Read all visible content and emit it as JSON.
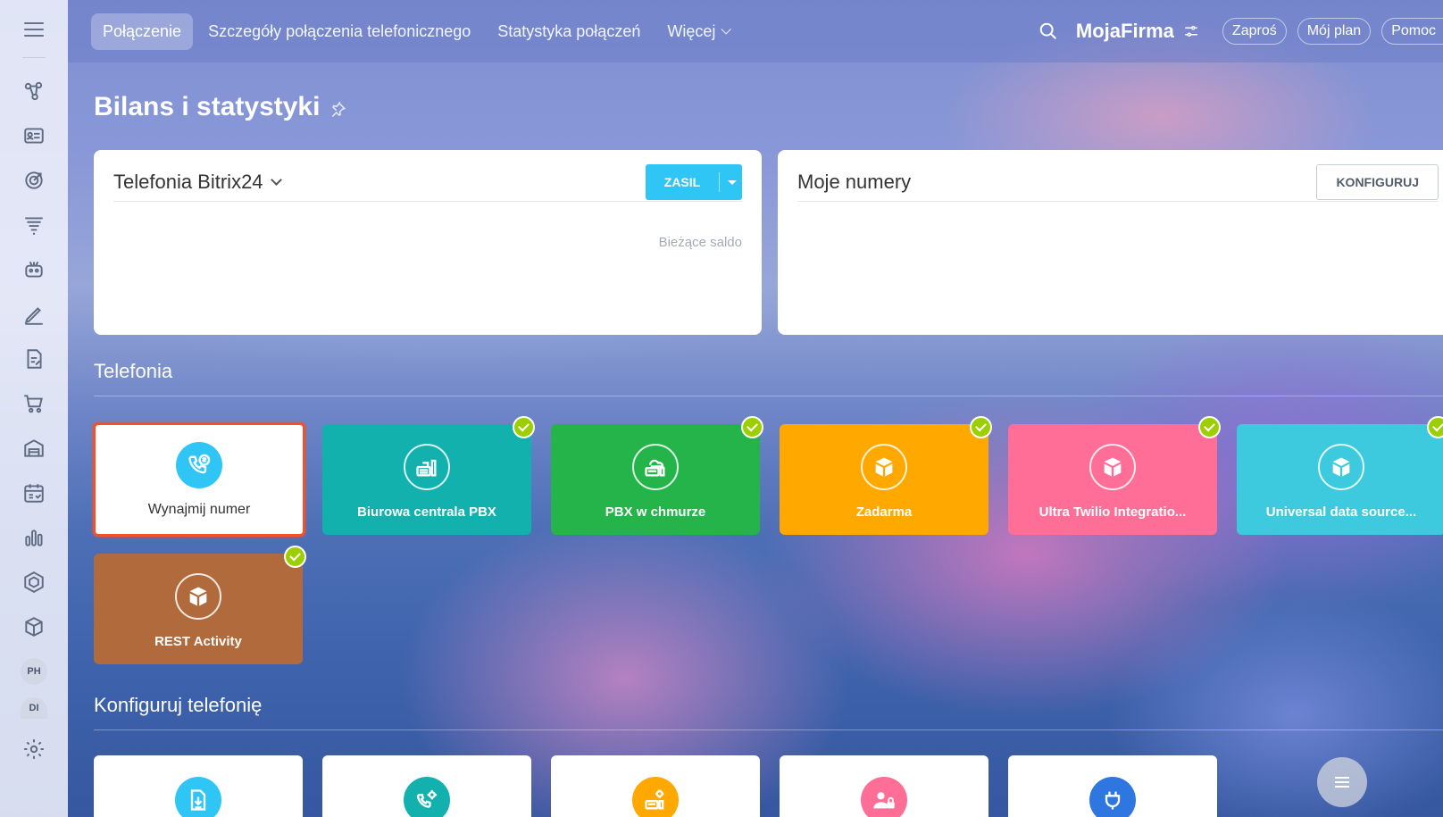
{
  "topbar": {
    "tabs": [
      {
        "label": "Połączenie",
        "active": true
      },
      {
        "label": "Szczegóły połączenia telefonicznego"
      },
      {
        "label": "Statystyka połączeń"
      },
      {
        "label": "Więcej"
      }
    ],
    "brand": "MojaFirma",
    "pills": [
      "Zaproś",
      "Mój plan",
      "Pomoc"
    ]
  },
  "sidebar": {
    "avatars": [
      "PH",
      "DI"
    ],
    "icons": [
      "crm-icon",
      "contact-center-icon",
      "target-icon",
      "funnel-icon",
      "robot-icon",
      "sign-icon",
      "document-icon",
      "cart-icon",
      "warehouse-icon",
      "booking-icon",
      "analytics-icon",
      "hexagon-icon",
      "package-icon",
      "settings-icon"
    ]
  },
  "page": {
    "title": "Bilans i statystyki"
  },
  "balance_card": {
    "title": "Telefonia Bitrix24",
    "button": "ZASIL",
    "saldo_label": "Bieżące saldo"
  },
  "numbers_card": {
    "title": "Moje numery",
    "button": "KONFIGURUJ"
  },
  "telefonia": {
    "title": "Telefonia",
    "tiles": [
      {
        "label": "Wynajmij numer",
        "color": "#ffffff",
        "checked": false
      },
      {
        "label": "Biurowa centrala PBX",
        "color": "#12b1ae",
        "checked": true
      },
      {
        "label": "PBX w chmurze",
        "color": "#24b44a",
        "checked": true
      },
      {
        "label": "Zadarma",
        "color": "#ffa900",
        "checked": true
      },
      {
        "label": "Ultra Twilio Integratio...",
        "color": "#ff6e96",
        "checked": true
      },
      {
        "label": "Universal data source...",
        "color": "#3dcadf",
        "checked": true
      },
      {
        "label": "REST Activity",
        "color": "#b06a3c",
        "checked": true
      }
    ]
  },
  "konfiguruj": {
    "title": "Konfiguruj telefonię",
    "tiles": [
      {
        "icon": "download-icon",
        "color": "#2fc6f6"
      },
      {
        "icon": "phone-settings-icon",
        "color": "#12b1ae"
      },
      {
        "icon": "pbx-settings-icon",
        "color": "#ffa900"
      },
      {
        "icon": "user-lock-icon",
        "color": "#ff6e96"
      },
      {
        "icon": "plug-icon",
        "color": "#2f77e0"
      }
    ]
  }
}
